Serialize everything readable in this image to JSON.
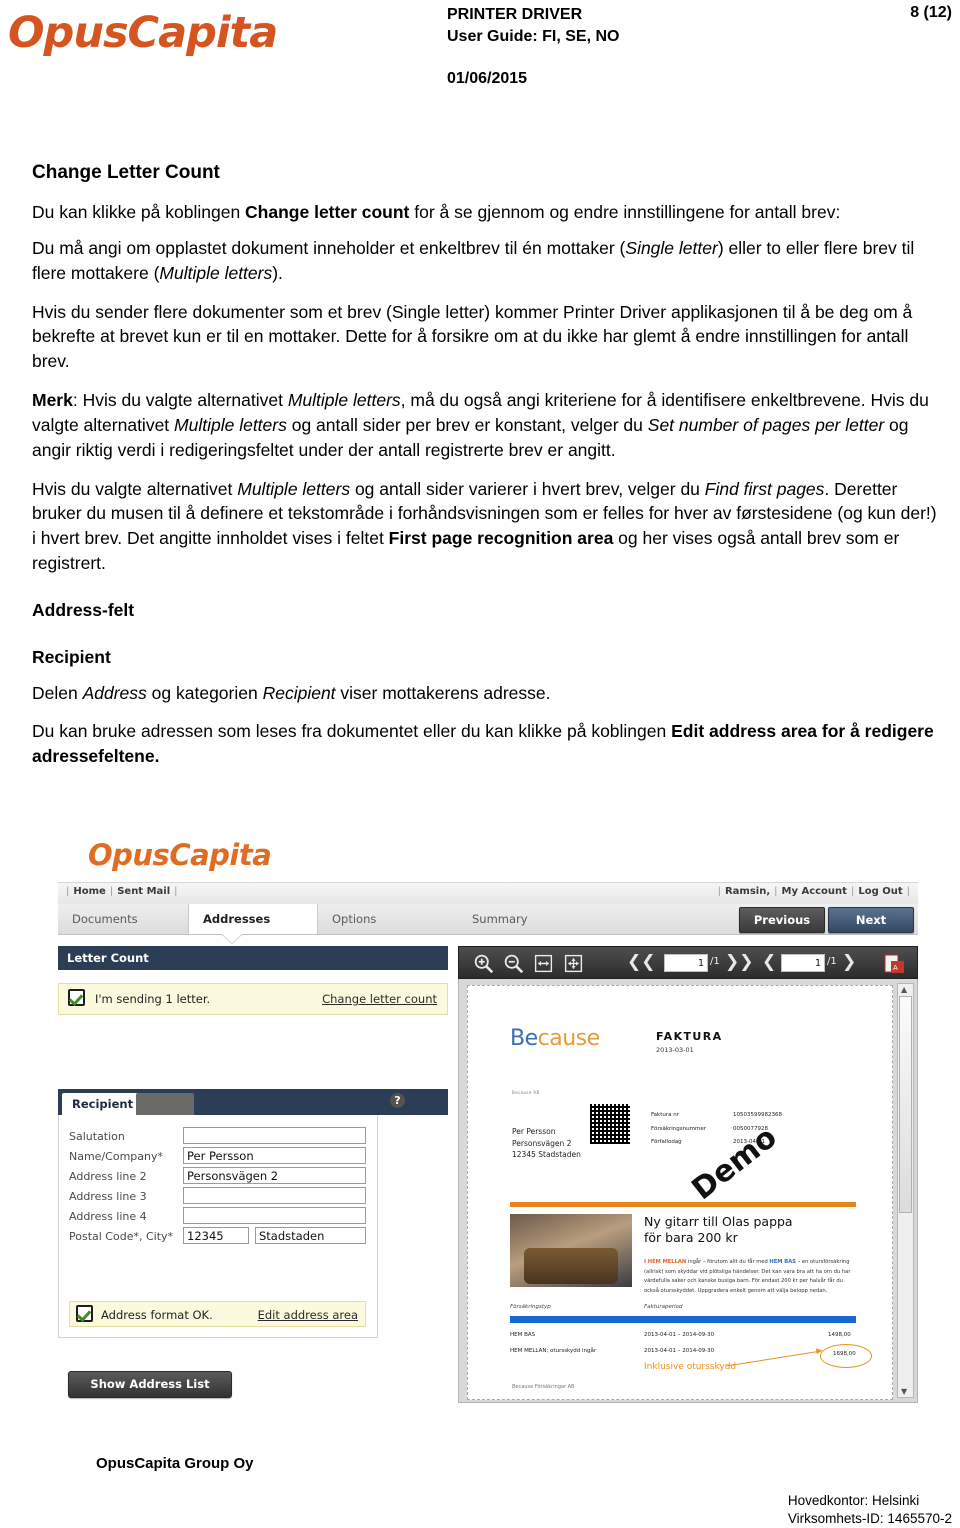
{
  "header": {
    "logo": "OpusCapita",
    "title_line1": "PRINTER DRIVER",
    "title_line2": "User Guide: FI, SE, NO",
    "date": "01/06/2015",
    "page_number": "8 (12)"
  },
  "document": {
    "heading": "Change Letter Count",
    "p1_a": "Du kan klikke på koblingen ",
    "p1_b": "Change letter count",
    "p1_c": " for å se gjennom og endre innstillingene for antall brev:",
    "p2_a": "Du må angi om opplastet dokument inneholder et enkeltbrev til én mottaker (",
    "p2_b": "Single letter",
    "p2_c": ") eller to eller flere brev til flere mottakere (",
    "p2_d": "Multiple letters",
    "p2_e": ").",
    "p3": "Hvis du sender flere dokumenter som et brev (Single letter) kommer Printer Driver applikasjonen til å be deg om å bekrefte at brevet kun er til en mottaker. Dette for å forsikre om at du ikke har glemt å endre innstillingen for antall brev.",
    "p4_merk": "Merk",
    "p4_a": ": Hvis du valgte alternativet ",
    "p4_b": "Multiple letters",
    "p4_c": ", må du også angi kriteriene for å identifisere enkeltbrevene. Hvis du valgte alternativet ",
    "p4_d": "Multiple letters",
    "p4_e": " og antall sider per brev er konstant, velger du ",
    "p4_f": "Set number of pages per letter",
    "p4_g": " og angir riktig verdi i redigeringsfeltet under der antall registrerte brev er angitt.",
    "p5_a": "Hvis du valgte alternativet ",
    "p5_b": "Multiple letters",
    "p5_c": " og antall sider varierer i hvert brev, velger du ",
    "p5_d": "Find first pages",
    "p5_e": ". Deretter bruker du musen til å definere et tekstområde i forhåndsvisningen som er felles for hver av førstesidene (og kun der!) i hvert brev. Det angitte innholdet vises i feltet ",
    "p5_f": "First page recognition area",
    "p5_g": " og her vises også antall brev som er registrert.",
    "heading2": "Address-felt",
    "heading3": "Recipient",
    "p6_a": "Delen ",
    "p6_b": "Address",
    "p6_c": " og kategorien ",
    "p6_d": "Recipient",
    "p6_e": " viser mottakerens adresse.",
    "p7_a": "Du kan bruke adressen som leses fra dokumentet eller du kan klikke på koblingen ",
    "p7_b": "Edit address area",
    "p7_c": " for å redigere adressefeltene."
  },
  "app": {
    "logo": "OpusCapita",
    "topnav_left": [
      "Home",
      "Sent Mail"
    ],
    "topnav_right": [
      "Ramsin,",
      "My Account",
      "Log Out"
    ],
    "tabs": [
      {
        "label": "Documents",
        "active": false
      },
      {
        "label": "Addresses",
        "active": true
      },
      {
        "label": "Options",
        "active": false
      },
      {
        "label": "Summary",
        "active": false
      }
    ],
    "previous_button": "Previous",
    "next_button": "Next",
    "letter_count": {
      "panel_title": "Letter Count",
      "status_text": "I'm sending 1 letter.",
      "change_link": "Change letter count"
    },
    "recipient": {
      "tab_label": "Recipient",
      "help_glyph": "?",
      "fields": [
        {
          "label": "Salutation",
          "value": ""
        },
        {
          "label": "Name/Company*",
          "value": "Per Persson"
        },
        {
          "label": "Address line 2",
          "value": "Personsvägen 2"
        },
        {
          "label": "Address line 3",
          "value": ""
        },
        {
          "label": "Address line 4",
          "value": ""
        }
      ],
      "postal_label": "Postal Code*, City*",
      "postal_code": "12345",
      "city": "Stadstaden",
      "format_ok_text": "Address format OK.",
      "edit_link": "Edit address area"
    },
    "show_address_list": "Show Address List",
    "preview_toolbar": {
      "zoom_in_icon": "zoom-in-icon",
      "zoom_out_icon": "zoom-out-icon",
      "fit_width_icon": "fit-width-icon",
      "fit_page_icon": "fit-page-icon",
      "letter_page_value": "1",
      "letter_page_total": "/1",
      "doc_page_value": "1",
      "doc_page_total": "/1",
      "pdf_icon": "pdf-export-icon"
    }
  },
  "invoice": {
    "logo_part1": "Be",
    "logo_part2": "cause",
    "doc_type": "FAKTURA",
    "doc_date": "2013-03-01",
    "tiny_sender": "Because AB",
    "address_lines": [
      "Per Persson",
      "Personsvägen 2",
      "12345 Stadstaden"
    ],
    "meta": [
      {
        "key": "Faktura nr",
        "value": "10503599982368"
      },
      {
        "key": "Försäkringsnummer",
        "value": "0050077928"
      },
      {
        "key": "Förfallodag",
        "value": "2013-04-01"
      }
    ],
    "watermark": "Demo",
    "headline_line1": "Ny gitarr till Olas pappa",
    "headline_line2": "för bara 200 kr",
    "body_hl1": "I HEM MELLAN",
    "body_a": " ingår – förutom allt du får med ",
    "body_hl2": "HEM BAS",
    "body_b": " – en otursförsäkring (allrisk) som skyddar vid plötsliga händelser. Det kan vara bra att ha om du har värdefulla saker och kanske busiga barn. För endast 200 kr per halvår får du också otursskyddet. Uppgradera enkelt genom att välja belopp nedan.",
    "col_header_1": "Försäkringstyp",
    "col_header_2": "Fakturaperiod",
    "rows": [
      {
        "type": "HEM BAS",
        "period": "2013-04-01 – 2014-09-30",
        "amount": "1498,00"
      },
      {
        "type": "HEM MELLAN; otursskydd ingår",
        "period": "2013-04-01 – 2014-09-30",
        "amount": "1698,00"
      }
    ],
    "annotation": "Inklusive otursskydd",
    "footer": "Because Försäkringar AB"
  },
  "page_footer": {
    "company": "OpusCapita Group Oy",
    "hq": "Hovedkontor: Helsinki",
    "biz_id": "Virksomhets-ID: 1465570-2"
  }
}
